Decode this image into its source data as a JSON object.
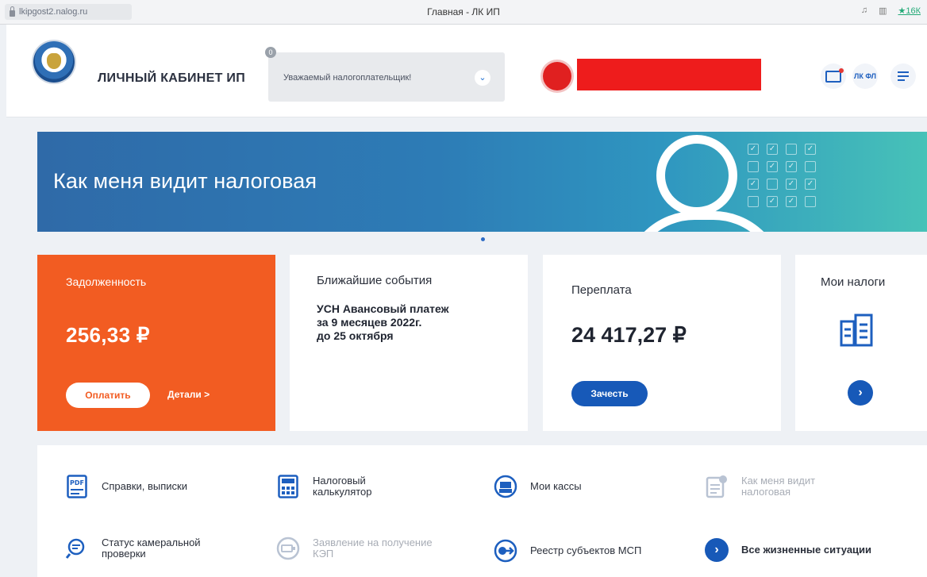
{
  "browser": {
    "url": "lkipgost2.nalog.ru",
    "tab_title": "Главная - ЛК ИП",
    "right_text": "★16К"
  },
  "header": {
    "cabinet_title": "ЛИЧНЫЙ КАБИНЕТ ИП",
    "notice_count": "0",
    "notice_text": "Уважаемый налогоплательщик!",
    "lk_label": "ЛК ФЛ"
  },
  "banner": {
    "title": "Как меня видит налоговая"
  },
  "cards": {
    "debt": {
      "label": "Задолженность",
      "amount": "256,33 ₽",
      "pay_label": "Оплатить",
      "details_label": "Детали >"
    },
    "events": {
      "label": "Ближайшие события",
      "line1": "УСН Авансовый платеж",
      "line2": "за 9 месяцев 2022г.",
      "line3": "до 25 октября"
    },
    "overpayment": {
      "label": "Переплата",
      "amount": "24 417,27 ₽",
      "offset_label": "Зачесть"
    },
    "taxes": {
      "label": "Мои налоги"
    }
  },
  "services": {
    "certificates": "Справки, выписки",
    "calculator_l1": "Налоговый",
    "calculator_l2": "калькулятор",
    "cash_registers": "Мои кассы",
    "tax_view_l1": "Как меня видит",
    "tax_view_l2": "налоговая",
    "audit_status_l1": "Статус камеральной",
    "audit_status_l2": "проверки",
    "kep_request_l1": "Заявление на получение",
    "kep_request_l2": "КЭП",
    "sme_registry": "Реестр субъектов МСП",
    "all_situations": "Все жизненные ситуации"
  },
  "colors": {
    "accent_blue": "#1759b8",
    "debt_orange": "#f25c22",
    "redaction_red": "#ee1c1c"
  }
}
